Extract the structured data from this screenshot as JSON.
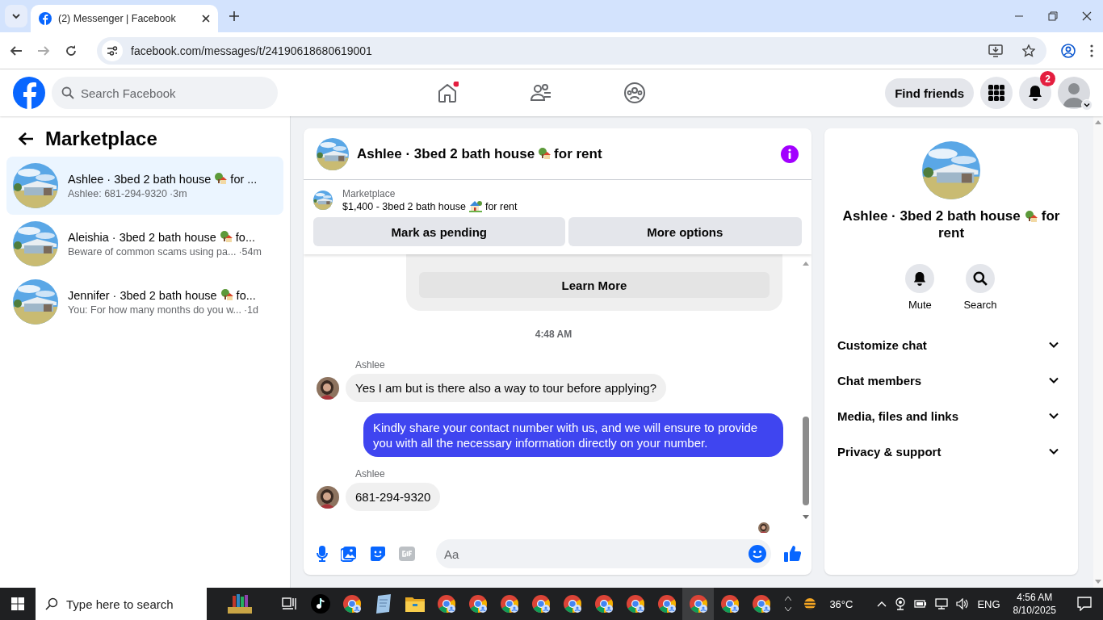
{
  "browser": {
    "tab_title": "(2) Messenger | Facebook",
    "url": "facebook.com/messages/t/24190618680619001"
  },
  "header": {
    "search_placeholder": "Search Facebook",
    "find_friends": "Find friends",
    "notification_count": "2"
  },
  "sidebar": {
    "title": "Marketplace",
    "conversations": [
      {
        "name": "Ashlee · 3bed 2 bath house",
        "name_end": "for ...",
        "preview": "Ashlee: 681-294-9320",
        "time": "·3m",
        "selected": true
      },
      {
        "name": "Aleishia · 3bed 2 bath house",
        "name_end": "fo...",
        "preview": "Beware of common scams using pa...",
        "time": "·54m",
        "selected": false
      },
      {
        "name": "Jennifer · 3bed 2 bath house",
        "name_end": "fo...",
        "preview": "You: For how many months do you w...",
        "time": "·1d",
        "selected": false
      }
    ]
  },
  "chat": {
    "title": "Ashlee · 3bed 2 bath house",
    "title_end": "for rent",
    "listing": {
      "label": "Marketplace",
      "price": "$1,400 - 3bed 2 bath house",
      "price_end": "for rent",
      "buttons": [
        "Mark as pending",
        "More options"
      ]
    },
    "notice_button": "Learn More",
    "timestamp": "4:48 AM",
    "messages": [
      {
        "kind": "incoming",
        "sender": "Ashlee",
        "text": "Yes I am but is there also a way to tour before applying?"
      },
      {
        "kind": "outgoing",
        "text": "Kindly share your contact number with us, and we will ensure to provide you with all the necessary information directly on your number."
      },
      {
        "kind": "incoming",
        "sender": "Ashlee",
        "text": "681-294-9320"
      }
    ],
    "composer_placeholder": "Aa"
  },
  "details": {
    "name": "Ashlee · 3bed 2 bath house",
    "name_end": "for rent",
    "actions": [
      {
        "kind": "mute",
        "label": "Mute"
      },
      {
        "kind": "search",
        "label": "Search"
      }
    ],
    "sections": [
      {
        "label": "Customize chat",
        "expanded": false
      },
      {
        "label": "Chat members",
        "expanded": false
      },
      {
        "label": "Media, files and links",
        "expanded": false
      },
      {
        "label": "Privacy & support",
        "expanded": false
      }
    ]
  },
  "taskbar": {
    "search_placeholder": "Type here to search",
    "apps": [
      {
        "kind": "books",
        "selected": false
      },
      {
        "kind": "taskview",
        "selected": false
      },
      {
        "kind": "note",
        "selected": false
      },
      {
        "kind": "browser",
        "selected": false
      },
      {
        "kind": "notepad",
        "selected": false
      },
      {
        "kind": "folder",
        "selected": false
      },
      {
        "kind": "browser",
        "selected": false
      },
      {
        "kind": "browser",
        "selected": false
      },
      {
        "kind": "browser",
        "selected": false
      },
      {
        "kind": "browser",
        "selected": false
      },
      {
        "kind": "browser",
        "selected": false
      },
      {
        "kind": "browser",
        "selected": false
      },
      {
        "kind": "browser",
        "selected": false
      },
      {
        "kind": "browser",
        "selected": false
      },
      {
        "kind": "browser",
        "selected": true
      },
      {
        "kind": "browser",
        "selected": false
      },
      {
        "kind": "browser",
        "selected": false
      }
    ],
    "temperature": "36°C",
    "language": "ENG",
    "time": "4:56 AM",
    "date": "8/10/2025"
  }
}
